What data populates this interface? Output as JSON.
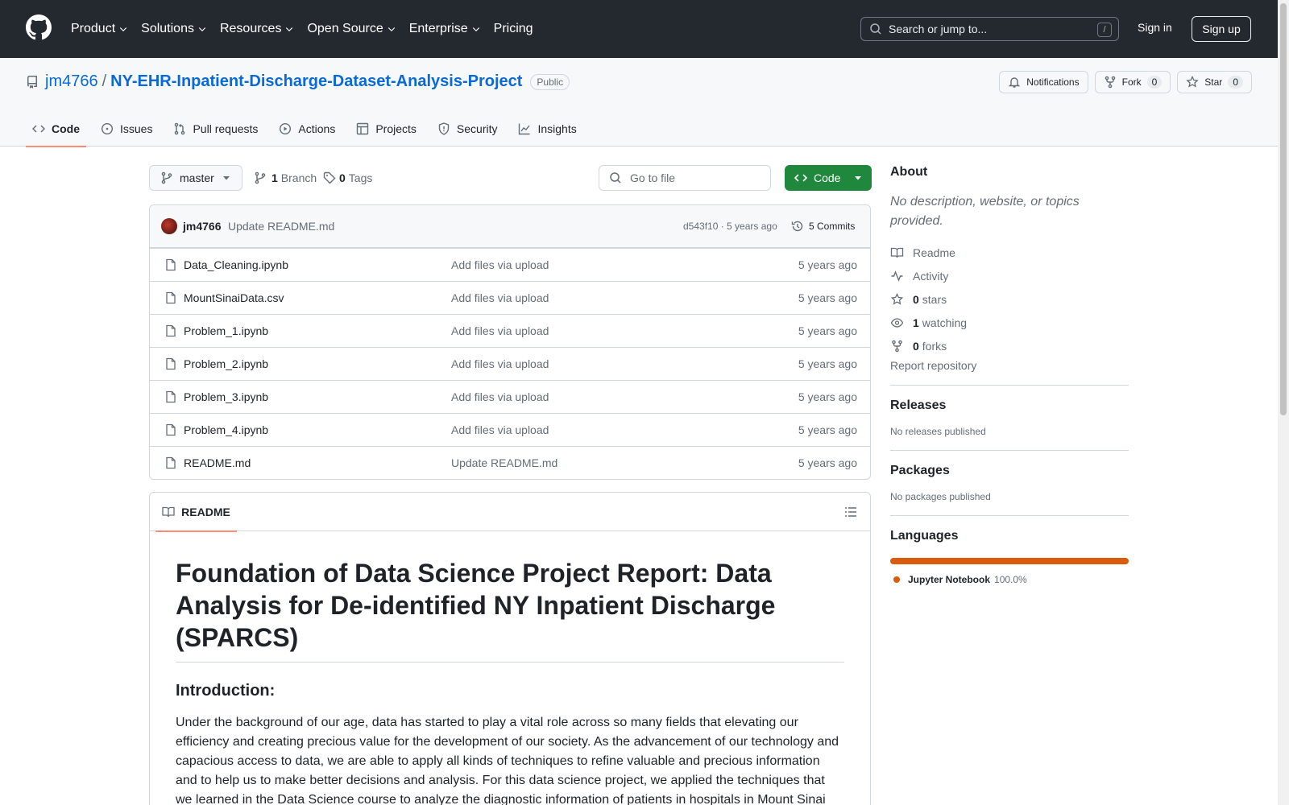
{
  "header": {
    "nav": [
      "Product",
      "Solutions",
      "Resources",
      "Open Source",
      "Enterprise",
      "Pricing"
    ],
    "search_placeholder": "Search or jump to...",
    "search_shortcut": "/",
    "sign_in": "Sign in",
    "sign_up": "Sign up"
  },
  "repo": {
    "owner": "jm4766",
    "separator": "/",
    "name": "NY-EHR-Inpatient-Discharge-Dataset-Analysis-Project",
    "visibility": "Public",
    "notifications_label": "Notifications",
    "fork_label": "Fork",
    "fork_count": "0",
    "star_label": "Star",
    "star_count": "0",
    "tabs": [
      "Code",
      "Issues",
      "Pull requests",
      "Actions",
      "Projects",
      "Security",
      "Insights"
    ]
  },
  "toolbar": {
    "branch": "master",
    "branch_count": "1",
    "branch_label": "Branch",
    "tag_count": "0",
    "tag_label": "Tags",
    "go_to_file": "Go to file",
    "code_button": "Code"
  },
  "commit": {
    "author": "jm4766",
    "message": "Update README.md",
    "meta": "d543f10 · 5 years ago",
    "commits": "5 Commits"
  },
  "files": [
    {
      "name": "Data_Cleaning.ipynb",
      "message": "Add files via upload",
      "date": "5 years ago"
    },
    {
      "name": "MountSinaiData.csv",
      "message": "Add files via upload",
      "date": "5 years ago"
    },
    {
      "name": "Problem_1.ipynb",
      "message": "Add files via upload",
      "date": "5 years ago"
    },
    {
      "name": "Problem_2.ipynb",
      "message": "Add files via upload",
      "date": "5 years ago"
    },
    {
      "name": "Problem_3.ipynb",
      "message": "Add files via upload",
      "date": "5 years ago"
    },
    {
      "name": "Problem_4.ipynb",
      "message": "Add files via upload",
      "date": "5 years ago"
    },
    {
      "name": "README.md",
      "message": "Update README.md",
      "date": "5 years ago"
    }
  ],
  "readme": {
    "tab": "README",
    "title": "Foundation of Data Science Project Report: Data Analysis for De-identified NY Inpatient Discharge (SPARCS)",
    "intro_heading": "Introduction:",
    "intro_text": "Under the background of our age, data has started to play a vital role across so many fields that elevating our efficiency and creating precious value for the development of our society. As the advancement of our technology and capacious access to data, we are able to apply all kinds of techniques to refine valuable and precious information and to help us to make better decisions and analysis. For this data science project, we applied the techniques that we learned in the Data Science course to analyze the diagnostic information of patients in hospitals in Mount Sinai"
  },
  "sidebar": {
    "about_title": "About",
    "about_desc": "No description, website, or topics provided.",
    "readme": "Readme",
    "activity": "Activity",
    "stars_count": "0",
    "stars_label": "stars",
    "watching_count": "1",
    "watching_label": "watching",
    "forks_count": "0",
    "forks_label": "forks",
    "report": "Report repository",
    "releases_title": "Releases",
    "releases_note": "No releases published",
    "packages_title": "Packages",
    "packages_note": "No packages published",
    "languages_title": "Languages",
    "language_name": "Jupyter Notebook",
    "language_pct": "100.0%",
    "language_color": "#DA5B0B",
    "language_fraction": 1.0
  },
  "colors": {
    "header_bg": "#24292f",
    "link": "#0969da",
    "primary_button": "#1f883d",
    "active_tab_underline": "#fd8c73"
  }
}
